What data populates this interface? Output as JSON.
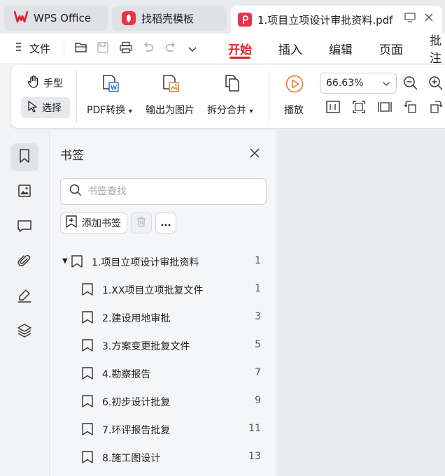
{
  "tabs": [
    {
      "label": "WPS Office",
      "icon": "wps-logo-icon"
    },
    {
      "label": "找稻壳模板",
      "icon": "docer-icon"
    },
    {
      "label": "1.项目立项设计审批资料.pdf",
      "icon": "pdf-icon"
    }
  ],
  "menubar": {
    "file_label": "文件",
    "tabs": [
      "开始",
      "插入",
      "编辑",
      "页面",
      "批注"
    ],
    "active_tab": "开始"
  },
  "ribbon": {
    "hand_label": "手型",
    "select_label": "选择",
    "pdf_convert_label": "PDF转换",
    "export_image_label": "输出为图片",
    "split_merge_label": "拆分合并",
    "play_label": "播放",
    "zoom_value": "66.63%"
  },
  "panel": {
    "title": "书签",
    "search_placeholder": "书签查找",
    "add_bookmark_label": "添加书签",
    "bookmarks": [
      {
        "label": "1.项目立项设计审批资料",
        "page": "1",
        "level": 0,
        "expanded": true
      },
      {
        "label": "1.XX项目立项批复文件",
        "page": "1",
        "level": 1
      },
      {
        "label": "2.建设用地审批",
        "page": "3",
        "level": 1
      },
      {
        "label": "3.方案变更批复文件",
        "page": "5",
        "level": 1
      },
      {
        "label": "4.勘察报告",
        "page": "7",
        "level": 1
      },
      {
        "label": "6.初步设计批复",
        "page": "9",
        "level": 1
      },
      {
        "label": "7.环评报告批复",
        "page": "11",
        "level": 1
      },
      {
        "label": "8.施工图设计",
        "page": "13",
        "level": 1
      }
    ]
  },
  "colors": {
    "accent": "#d9232c",
    "pdf_tab_icon": "#e8334a",
    "docer_icon": "#e8334a"
  }
}
